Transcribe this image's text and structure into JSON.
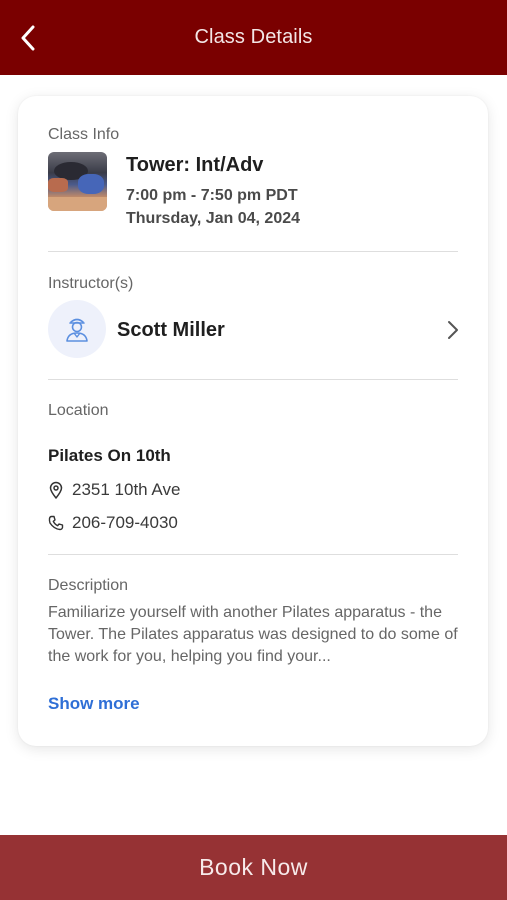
{
  "header": {
    "title": "Class Details",
    "back_icon": "chevron-left-icon"
  },
  "class_info": {
    "section_label": "Class Info",
    "name": "Tower: Int/Adv",
    "time": "7:00 pm - 7:50 pm PDT",
    "date": "Thursday, Jan 04, 2024"
  },
  "instructors": {
    "section_label": "Instructor(s)",
    "name": "Scott Miller",
    "avatar_icon": "person-icon"
  },
  "location": {
    "section_label": "Location",
    "name": "Pilates On 10th",
    "address": "2351 10th Ave",
    "phone": "206-709-4030"
  },
  "description": {
    "section_label": "Description",
    "text": "Familiarize yourself with another Pilates apparatus - the Tower. The Pilates apparatus was designed to do some of the work for you, helping you find your...",
    "show_more_label": "Show more"
  },
  "book_button": {
    "label": "Book Now"
  },
  "colors": {
    "header_bg": "#7a0000",
    "book_bg": "#963234",
    "link": "#2f6fd6",
    "avatar_bg": "#eef1fb",
    "avatar_stroke": "#5b8fe0"
  }
}
